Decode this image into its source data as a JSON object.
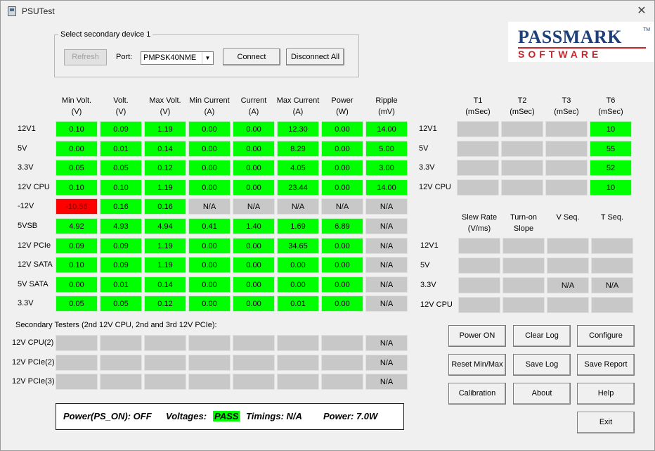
{
  "window": {
    "title": "PSUTest",
    "close_glyph": "✕"
  },
  "device": {
    "group_label": "Select secondary device 1",
    "refresh_label": "Refresh",
    "port_label": "Port:",
    "port_value": "PMPSK40NME",
    "connect_label": "Connect",
    "disconnect_all_label": "Disconnect All"
  },
  "logo": {
    "line1": "PASSMARK",
    "line2": "SOFTWARE",
    "tm": "TM"
  },
  "main_table": {
    "columns": [
      {
        "l1": "Min Volt.",
        "l2": "(V)"
      },
      {
        "l1": "Volt.",
        "l2": "(V)"
      },
      {
        "l1": "Max Volt.",
        "l2": "(V)"
      },
      {
        "l1": "Min Current",
        "l2": "(A)"
      },
      {
        "l1": "Current",
        "l2": "(A)"
      },
      {
        "l1": "Max Current",
        "l2": "(A)"
      },
      {
        "l1": "Power",
        "l2": "(W)"
      },
      {
        "l1": "Ripple",
        "l2": "(mV)"
      }
    ],
    "rows": [
      {
        "label": "12V1",
        "cells": [
          [
            "0.10",
            "g"
          ],
          [
            "0.09",
            "g"
          ],
          [
            "1.19",
            "g"
          ],
          [
            "0.00",
            "g"
          ],
          [
            "0.00",
            "g"
          ],
          [
            "12.30",
            "g"
          ],
          [
            "0.00",
            "g"
          ],
          [
            "14.00",
            "g"
          ]
        ]
      },
      {
        "label": "5V",
        "cells": [
          [
            "0.00",
            "g"
          ],
          [
            "0.01",
            "g"
          ],
          [
            "0.14",
            "g"
          ],
          [
            "0.00",
            "g"
          ],
          [
            "0.00",
            "g"
          ],
          [
            "8.29",
            "g"
          ],
          [
            "0.00",
            "g"
          ],
          [
            "5.00",
            "g"
          ]
        ]
      },
      {
        "label": "3.3V",
        "cells": [
          [
            "0.05",
            "g"
          ],
          [
            "0.05",
            "g"
          ],
          [
            "0.12",
            "g"
          ],
          [
            "0.00",
            "g"
          ],
          [
            "0.00",
            "g"
          ],
          [
            "4.05",
            "g"
          ],
          [
            "0.00",
            "g"
          ],
          [
            "3.00",
            "g"
          ]
        ]
      },
      {
        "label": "12V CPU",
        "cells": [
          [
            "0.10",
            "g"
          ],
          [
            "0.10",
            "g"
          ],
          [
            "1.19",
            "g"
          ],
          [
            "0.00",
            "g"
          ],
          [
            "0.00",
            "g"
          ],
          [
            "23.44",
            "g"
          ],
          [
            "0.00",
            "g"
          ],
          [
            "14.00",
            "g"
          ]
        ]
      },
      {
        "label": "-12V",
        "cells": [
          [
            "-10.56",
            "r"
          ],
          [
            "0.16",
            "g"
          ],
          [
            "0.16",
            "g"
          ],
          [
            "N/A",
            "x"
          ],
          [
            "N/A",
            "x"
          ],
          [
            "N/A",
            "x"
          ],
          [
            "N/A",
            "x"
          ],
          [
            "N/A",
            "x"
          ]
        ]
      },
      {
        "label": "5VSB",
        "cells": [
          [
            "4.92",
            "g"
          ],
          [
            "4.93",
            "g"
          ],
          [
            "4.94",
            "g"
          ],
          [
            "0.41",
            "g"
          ],
          [
            "1.40",
            "g"
          ],
          [
            "1.69",
            "g"
          ],
          [
            "6.89",
            "g"
          ],
          [
            "N/A",
            "x"
          ]
        ]
      },
      {
        "label": "12V PCIe",
        "cells": [
          [
            "0.09",
            "g"
          ],
          [
            "0.09",
            "g"
          ],
          [
            "1.19",
            "g"
          ],
          [
            "0.00",
            "g"
          ],
          [
            "0.00",
            "g"
          ],
          [
            "34.65",
            "g"
          ],
          [
            "0.00",
            "g"
          ],
          [
            "N/A",
            "x"
          ]
        ]
      },
      {
        "label": "12V SATA",
        "cells": [
          [
            "0.10",
            "g"
          ],
          [
            "0.09",
            "g"
          ],
          [
            "1.19",
            "g"
          ],
          [
            "0.00",
            "g"
          ],
          [
            "0.00",
            "g"
          ],
          [
            "0.00",
            "g"
          ],
          [
            "0.00",
            "g"
          ],
          [
            "N/A",
            "x"
          ]
        ]
      },
      {
        "label": "5V SATA",
        "cells": [
          [
            "0.00",
            "g"
          ],
          [
            "0.01",
            "g"
          ],
          [
            "0.14",
            "g"
          ],
          [
            "0.00",
            "g"
          ],
          [
            "0.00",
            "g"
          ],
          [
            "0.00",
            "g"
          ],
          [
            "0.00",
            "g"
          ],
          [
            "N/A",
            "x"
          ]
        ]
      },
      {
        "label": "3.3V",
        "cells": [
          [
            "0.05",
            "g"
          ],
          [
            "0.05",
            "g"
          ],
          [
            "0.12",
            "g"
          ],
          [
            "0.00",
            "g"
          ],
          [
            "0.00",
            "g"
          ],
          [
            "0.01",
            "g"
          ],
          [
            "0.00",
            "g"
          ],
          [
            "N/A",
            "x"
          ]
        ]
      }
    ]
  },
  "secondary": {
    "heading": "Secondary Testers (2nd 12V CPU, 2nd and 3rd 12V PCIe):",
    "rows": [
      {
        "label": "12V CPU(2)",
        "cells": [
          [
            "",
            "x"
          ],
          [
            "",
            "x"
          ],
          [
            "",
            "x"
          ],
          [
            "",
            "x"
          ],
          [
            "",
            "x"
          ],
          [
            "",
            "x"
          ],
          [
            "",
            "x"
          ],
          [
            "N/A",
            "x"
          ]
        ]
      },
      {
        "label": "12V PCIe(2)",
        "cells": [
          [
            "",
            "x"
          ],
          [
            "",
            "x"
          ],
          [
            "",
            "x"
          ],
          [
            "",
            "x"
          ],
          [
            "",
            "x"
          ],
          [
            "",
            "x"
          ],
          [
            "",
            "x"
          ],
          [
            "N/A",
            "x"
          ]
        ]
      },
      {
        "label": "12V PCIe(3)",
        "cells": [
          [
            "",
            "x"
          ],
          [
            "",
            "x"
          ],
          [
            "",
            "x"
          ],
          [
            "",
            "x"
          ],
          [
            "",
            "x"
          ],
          [
            "",
            "x"
          ],
          [
            "",
            "x"
          ],
          [
            "N/A",
            "x"
          ]
        ]
      }
    ]
  },
  "timing_table": {
    "columns": [
      {
        "l1": "T1",
        "l2": "(mSec)"
      },
      {
        "l1": "T2",
        "l2": "(mSec)"
      },
      {
        "l1": "T3",
        "l2": "(mSec)"
      },
      {
        "l1": "T6",
        "l2": "(mSec)"
      }
    ],
    "rows": [
      {
        "label": "12V1",
        "cells": [
          [
            "",
            "x"
          ],
          [
            "",
            "x"
          ],
          [
            "",
            "x"
          ],
          [
            "10",
            "g"
          ]
        ]
      },
      {
        "label": "5V",
        "cells": [
          [
            "",
            "x"
          ],
          [
            "",
            "x"
          ],
          [
            "",
            "x"
          ],
          [
            "55",
            "g"
          ]
        ]
      },
      {
        "label": "3.3V",
        "cells": [
          [
            "",
            "x"
          ],
          [
            "",
            "x"
          ],
          [
            "",
            "x"
          ],
          [
            "52",
            "g"
          ]
        ]
      },
      {
        "label": "12V CPU",
        "cells": [
          [
            "",
            "x"
          ],
          [
            "",
            "x"
          ],
          [
            "",
            "x"
          ],
          [
            "10",
            "g"
          ]
        ]
      }
    ]
  },
  "slew_table": {
    "columns": [
      {
        "l1": "Slew Rate",
        "l2": "(V/ms)"
      },
      {
        "l1": "Turn-on",
        "l2": "Slope"
      },
      {
        "l1": "V Seq.",
        "l2": ""
      },
      {
        "l1": "T Seq.",
        "l2": ""
      }
    ],
    "rows": [
      {
        "label": "12V1",
        "cells": [
          [
            "",
            "x"
          ],
          [
            "",
            "x"
          ],
          [
            "",
            "x"
          ],
          [
            "",
            "x"
          ]
        ]
      },
      {
        "label": "5V",
        "cells": [
          [
            "",
            "x"
          ],
          [
            "",
            "x"
          ],
          [
            "",
            "x"
          ],
          [
            "",
            "x"
          ]
        ]
      },
      {
        "label": "3.3V",
        "cells": [
          [
            "",
            "x"
          ],
          [
            "",
            "x"
          ],
          [
            "N/A",
            "x"
          ],
          [
            "N/A",
            "x"
          ]
        ]
      },
      {
        "label": "12V CPU",
        "cells": [
          [
            "",
            "x"
          ],
          [
            "",
            "x"
          ],
          [
            "",
            "x"
          ],
          [
            "",
            "x"
          ]
        ]
      }
    ]
  },
  "buttons": {
    "power_on": "Power ON",
    "clear_log": "Clear Log",
    "configure": "Configure",
    "reset_minmax": "Reset Min/Max",
    "save_log": "Save Log",
    "save_report": "Save Report",
    "calibration": "Calibration",
    "about": "About",
    "help": "Help",
    "exit": "Exit"
  },
  "status": {
    "ps_on": "Power(PS_ON): OFF",
    "voltages_label": "Voltages:",
    "voltages_value": "PASS",
    "timings": "Timings: N/A",
    "power": "Power: 7.0W"
  },
  "colors": {
    "green": "#00ff00",
    "red": "#ff0000",
    "gray": "#c8c8c8"
  }
}
